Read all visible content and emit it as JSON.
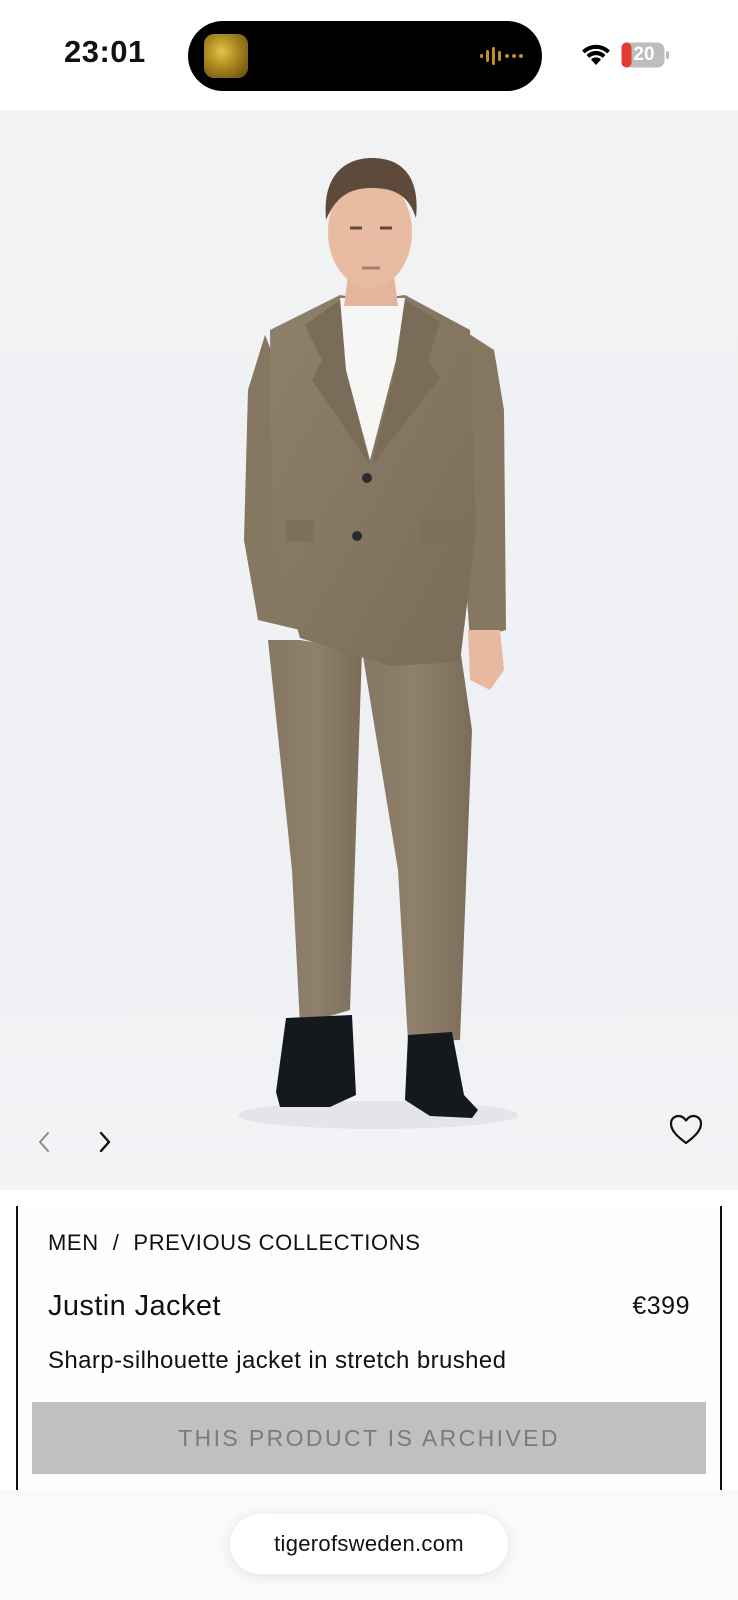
{
  "status_bar": {
    "time": "23:01",
    "battery_level": "20",
    "battery_color": "#e53935",
    "icons": [
      "now-playing-artwork-icon",
      "audio-waveform-icon",
      "wifi-icon",
      "battery-icon"
    ]
  },
  "product": {
    "breadcrumb": [
      "MEN",
      "/",
      "PREVIOUS COLLECTIONS"
    ],
    "name": "Justin Jacket",
    "price": "€399",
    "description": "Sharp-silhouette jacket in stretch brushed",
    "archived_notice": "THIS PRODUCT IS ARCHIVED"
  },
  "gallery": {
    "icons": [
      "chevron-left-icon",
      "chevron-right-icon",
      "heart-icon"
    ]
  },
  "browser": {
    "url": "tigerofsweden.com"
  }
}
